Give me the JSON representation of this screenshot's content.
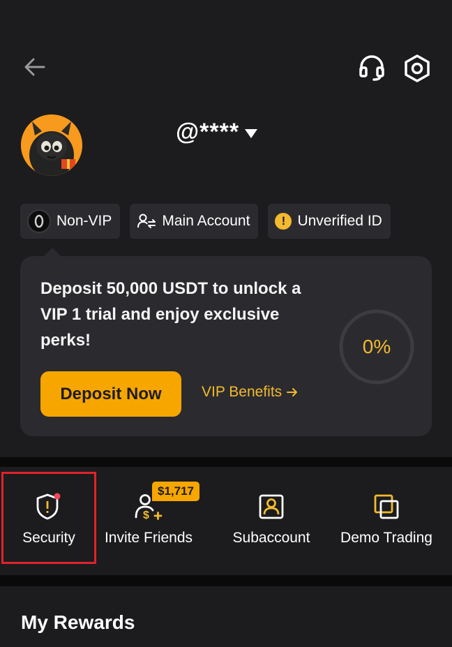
{
  "header": {
    "back_icon": "arrow-left-icon",
    "support_icon": "headset-icon",
    "settings_icon": "gear-icon"
  },
  "profile": {
    "username": "@****",
    "avatar": "monster-avatar"
  },
  "chips": {
    "vip": "Non-VIP",
    "account": "Main Account",
    "verification": "Unverified ID"
  },
  "promo": {
    "text": "Deposit 50,000 USDT to unlock a VIP 1 trial and enjoy exclusive perks!",
    "progress_label": "0%",
    "progress_fraction": 0,
    "deposit_button": "Deposit Now",
    "benefits_link": "VIP Benefits"
  },
  "shortcuts": {
    "security": "Security",
    "invite": "Invite Friends",
    "invite_badge": "$1,717",
    "subaccount": "Subaccount",
    "demo": "Demo Trading"
  },
  "rewards": {
    "title": "My Rewards"
  },
  "colors": {
    "accent": "#f7a600",
    "highlight": "#e1222b",
    "background": "#1c1c1e"
  }
}
